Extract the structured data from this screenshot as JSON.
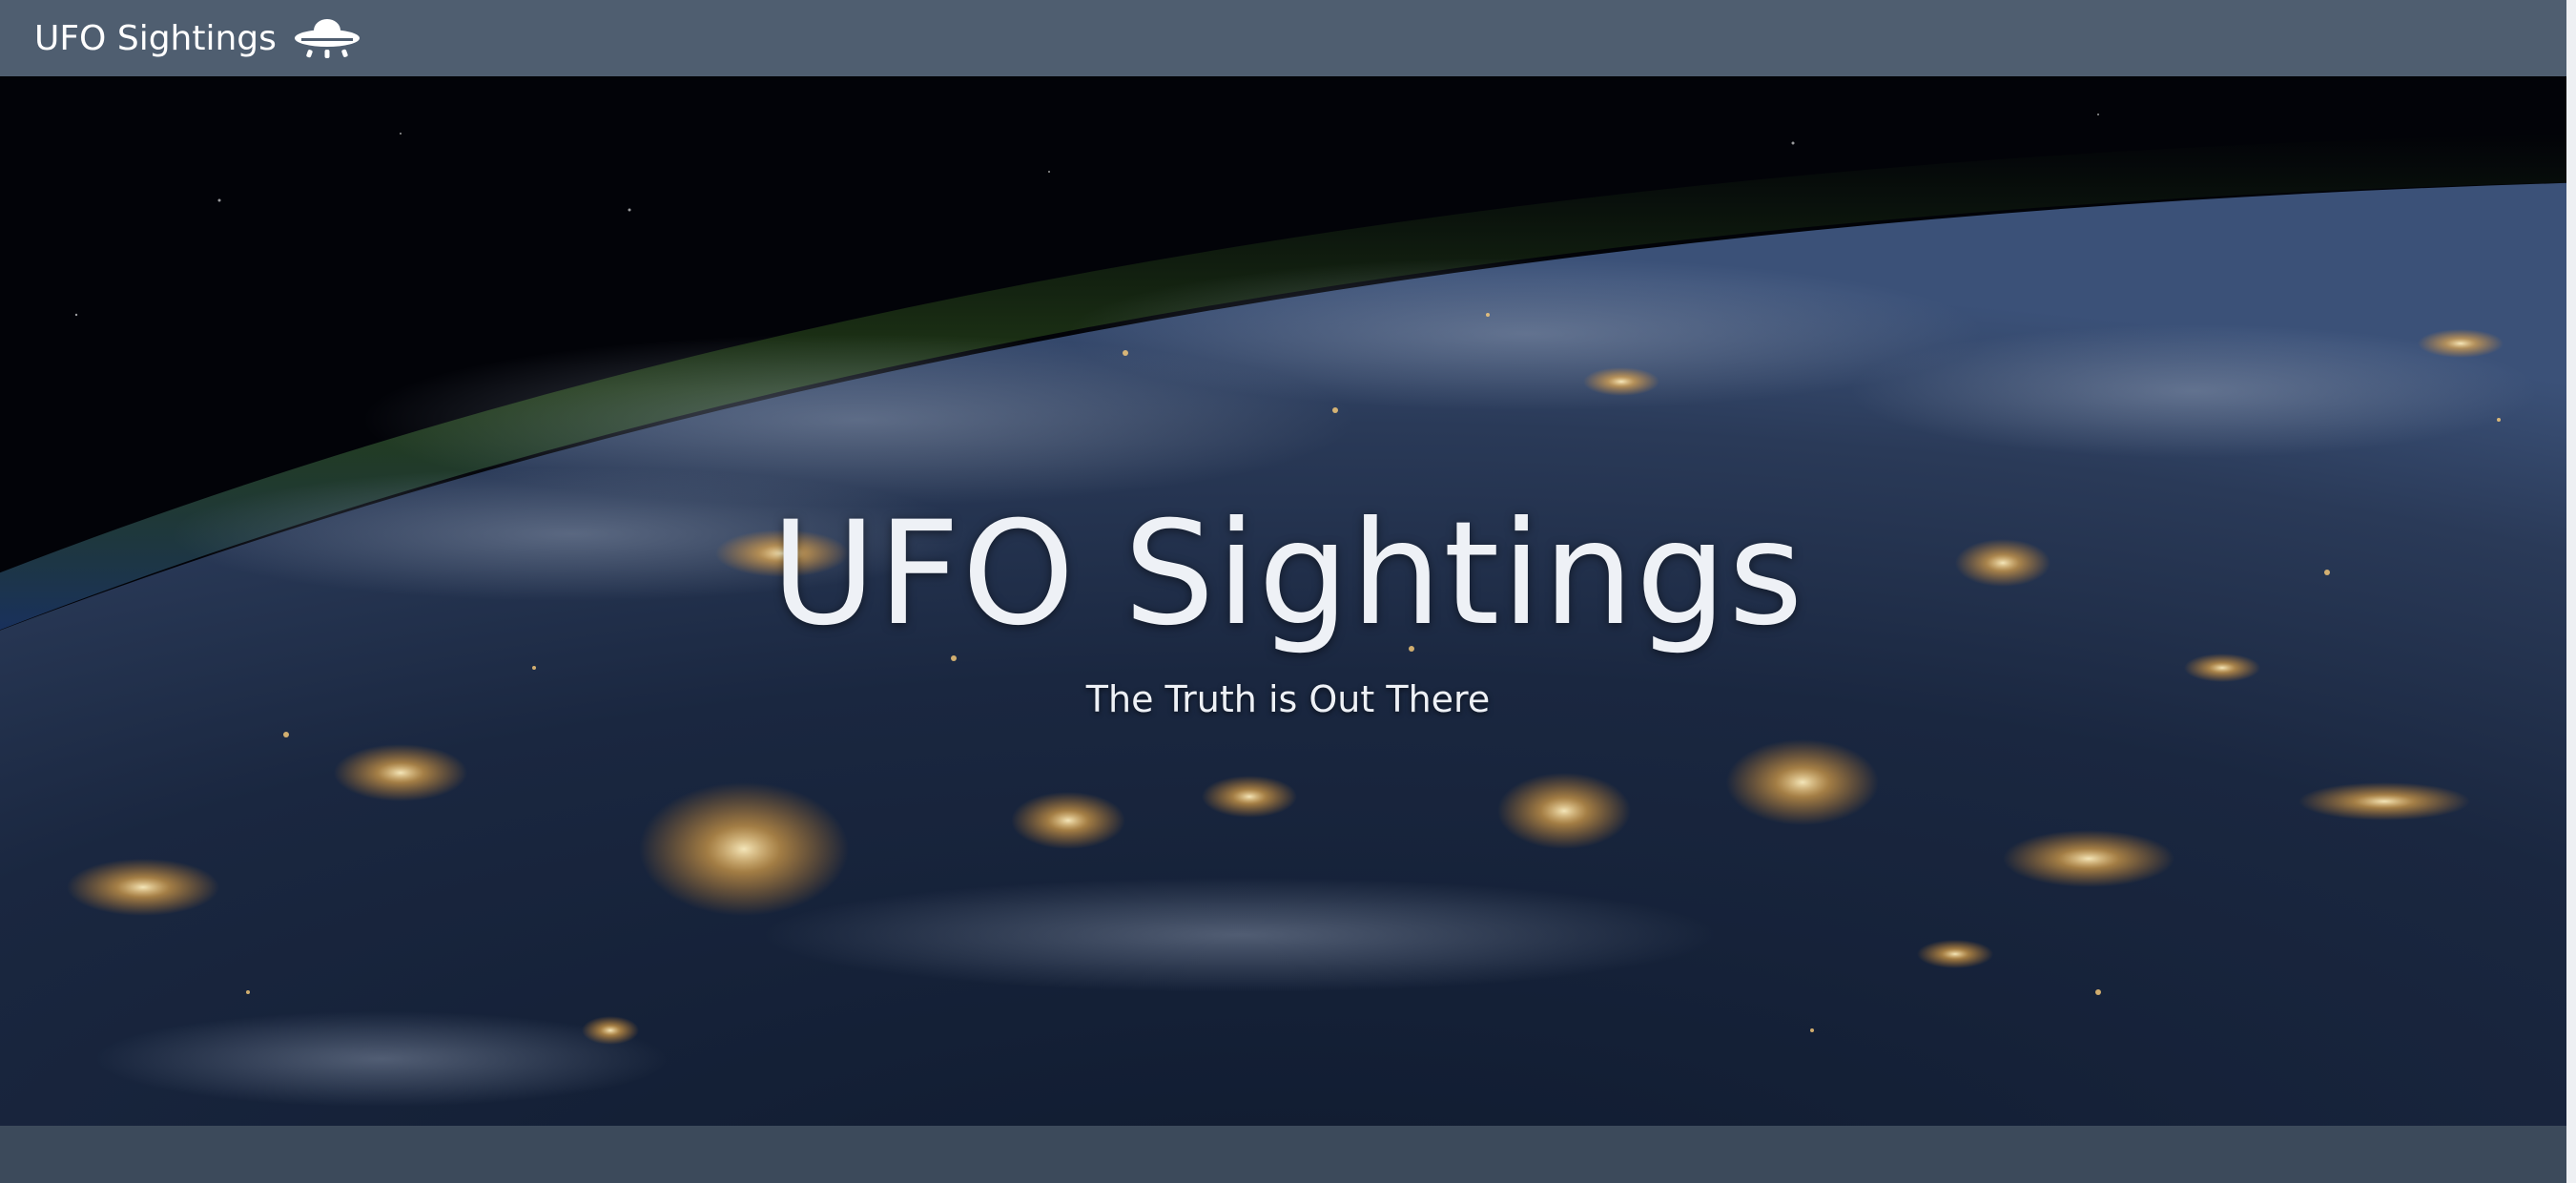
{
  "navbar": {
    "brand_label": "UFO Sightings",
    "brand_icon": "ufo-icon"
  },
  "hero": {
    "title": "UFO Sightings",
    "subtitle": "The Truth is Out There",
    "background": "earth-at-night-from-space"
  },
  "colors": {
    "navbar_bg": "#4f5e70",
    "footer_bg": "#3c4a5b",
    "text": "#eef1f6"
  }
}
